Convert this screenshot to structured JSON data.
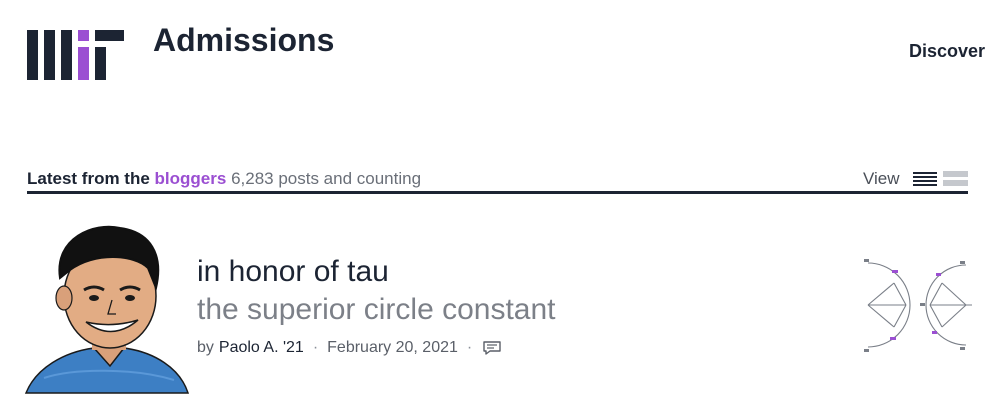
{
  "header": {
    "brand_title": "Admissions",
    "nav": [
      {
        "label": "Discover"
      }
    ]
  },
  "colors": {
    "primary": "#1c2433",
    "accent": "#9b4fd2",
    "muted": "#7c8088"
  },
  "section": {
    "title_lead": "Latest from the",
    "title_accent": "bloggers",
    "count_text": "6,283 posts and counting",
    "view_label": "View",
    "view_options": [
      {
        "icon": "list-view-icon",
        "selected": true
      },
      {
        "icon": "grid-view-icon",
        "selected": false
      }
    ]
  },
  "post": {
    "title": "in honor of tau",
    "subtitle": "the superior circle constant",
    "by_prefix": "by",
    "author": "Paolo A. '21",
    "date": "February 20, 2021",
    "separator": "·",
    "avatar_icon": "blogger-avatar-illustration",
    "comment_icon": "comment-icon",
    "thumbnail_icon": "unit-circle-diagram-thumbnail"
  }
}
